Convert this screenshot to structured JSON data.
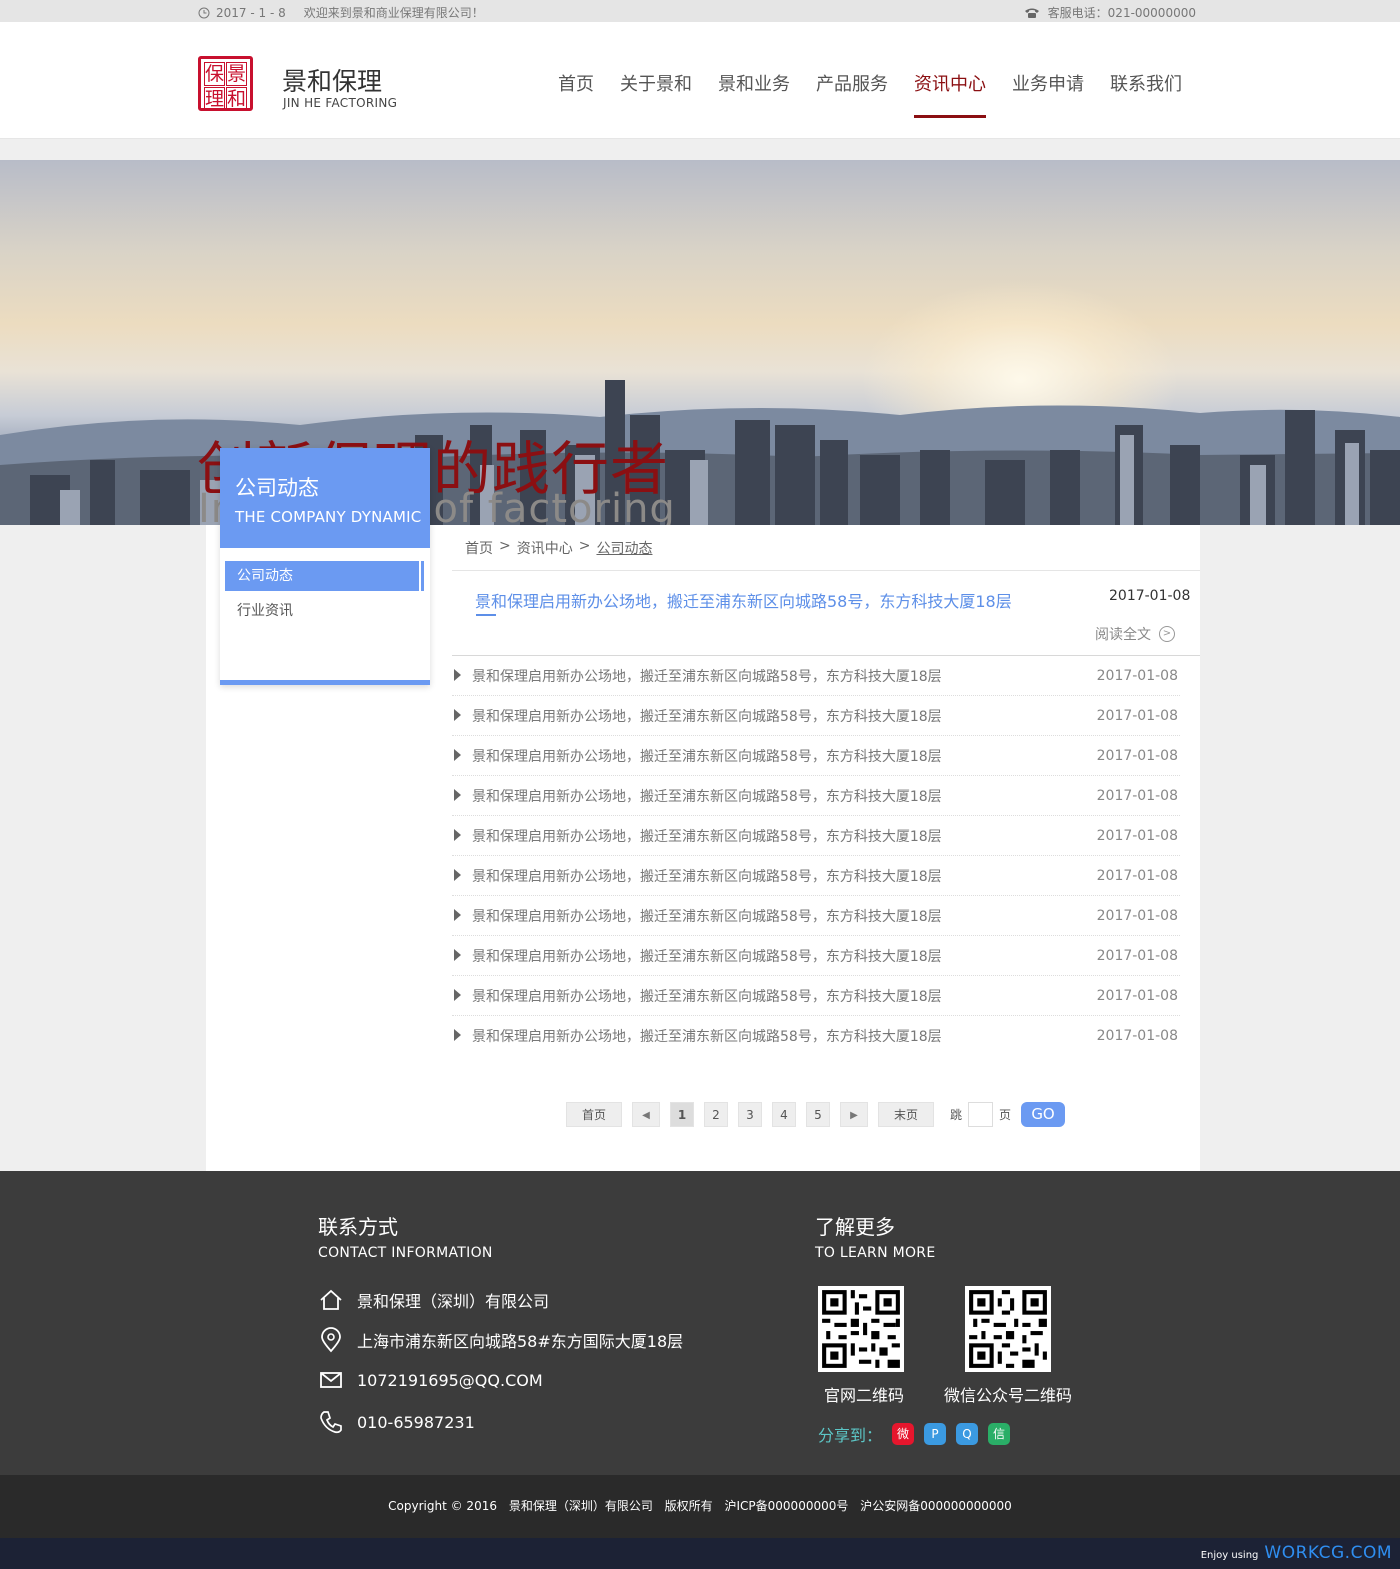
{
  "topbar": {
    "date": "2017 - 1 - 8",
    "welcome": "欢迎来到景和商业保理有限公司！",
    "hotline": "客服电话：021-00000000"
  },
  "header": {
    "logo_chars": [
      "保",
      "景",
      "理",
      "和"
    ],
    "brand_name": "景和保理",
    "brand_en": "JIN HE FACTORING",
    "nav": [
      {
        "label": "首页",
        "active": false
      },
      {
        "label": "关于景和",
        "active": false
      },
      {
        "label": "景和业务",
        "active": false
      },
      {
        "label": "产品服务",
        "active": false
      },
      {
        "label": "资讯中心",
        "active": true
      },
      {
        "label": "业务申请",
        "active": false
      },
      {
        "label": "联系我们",
        "active": false
      }
    ]
  },
  "banner": {
    "slogan_cn": "创新保理的践行者",
    "slogan_en": "Innovation of factoring"
  },
  "sidebar": {
    "title_cn": "公司动态",
    "title_en": "THE COMPANY DYNAMIC",
    "items": [
      {
        "label": "公司动态",
        "active": true
      },
      {
        "label": "行业资讯",
        "active": false
      }
    ]
  },
  "breadcrumb": {
    "home": "首页",
    "sep": ">",
    "section": "资讯中心",
    "current": "公司动态"
  },
  "featured": {
    "title": "景和保理启用新办公场地，搬迁至浦东新区向城路58号，东方科技大厦18层",
    "date": "2017-01-08",
    "read_more": "阅读全文",
    "read_more_icon": "chevron-right-icon"
  },
  "news": [
    {
      "title": "景和保理启用新办公场地，搬迁至浦东新区向城路58号，东方科技大厦18层",
      "date": "2017-01-08"
    },
    {
      "title": "景和保理启用新办公场地，搬迁至浦东新区向城路58号，东方科技大厦18层",
      "date": "2017-01-08"
    },
    {
      "title": "景和保理启用新办公场地，搬迁至浦东新区向城路58号，东方科技大厦18层",
      "date": "2017-01-08"
    },
    {
      "title": "景和保理启用新办公场地，搬迁至浦东新区向城路58号，东方科技大厦18层",
      "date": "2017-01-08"
    },
    {
      "title": "景和保理启用新办公场地，搬迁至浦东新区向城路58号，东方科技大厦18层",
      "date": "2017-01-08"
    },
    {
      "title": "景和保理启用新办公场地，搬迁至浦东新区向城路58号，东方科技大厦18层",
      "date": "2017-01-08"
    },
    {
      "title": "景和保理启用新办公场地，搬迁至浦东新区向城路58号，东方科技大厦18层",
      "date": "2017-01-08"
    },
    {
      "title": "景和保理启用新办公场地，搬迁至浦东新区向城路58号，东方科技大厦18层",
      "date": "2017-01-08"
    },
    {
      "title": "景和保理启用新办公场地，搬迁至浦东新区向城路58号，东方科技大厦18层",
      "date": "2017-01-08"
    },
    {
      "title": "景和保理启用新办公场地，搬迁至浦东新区向城路58号，东方科技大厦18层",
      "date": "2017-01-08"
    }
  ],
  "pager": {
    "first": "首页",
    "prev": "◀",
    "pages": [
      "1",
      "2",
      "3",
      "4",
      "5"
    ],
    "current": "1",
    "next": "▶",
    "last": "末页",
    "jump_label": "跳",
    "page_unit": "页",
    "go": "GO"
  },
  "footer": {
    "contact_title": "联系方式",
    "contact_en": "CONTACT INFORMATION",
    "company": "景和保理（深圳）有限公司",
    "address": "上海市浦东新区向城路58#东方国际大厦18层",
    "email": "1072191695@QQ.COM",
    "phone": "010-65987231",
    "more_title": "了解更多",
    "more_en": "TO LEARN MORE",
    "qr1_label": "官网二维码",
    "qr2_label": "微信公众号二维码",
    "share_label": "分享到：",
    "share_icons": [
      {
        "name": "weibo-icon",
        "color": "#e6162d"
      },
      {
        "name": "tencent-weibo-icon",
        "color": "#3b9ae1"
      },
      {
        "name": "qq-icon",
        "color": "#3b9ae1"
      },
      {
        "name": "wechat-icon",
        "color": "#2aae67"
      }
    ]
  },
  "copyright": {
    "text": "Copyright © 2016",
    "company": "景和保理（深圳）有限公司",
    "rights": "版权所有",
    "icp": "沪ICP备000000000号",
    "police": "沪公安网备000000000000"
  },
  "watermark": {
    "enjoy": "Enjoy using",
    "brand": "WORKCG.COM"
  },
  "colors": {
    "accent_blue": "#6b9af2",
    "brand_red": "#8b0f12",
    "footer_bg": "#3c3c3c"
  }
}
